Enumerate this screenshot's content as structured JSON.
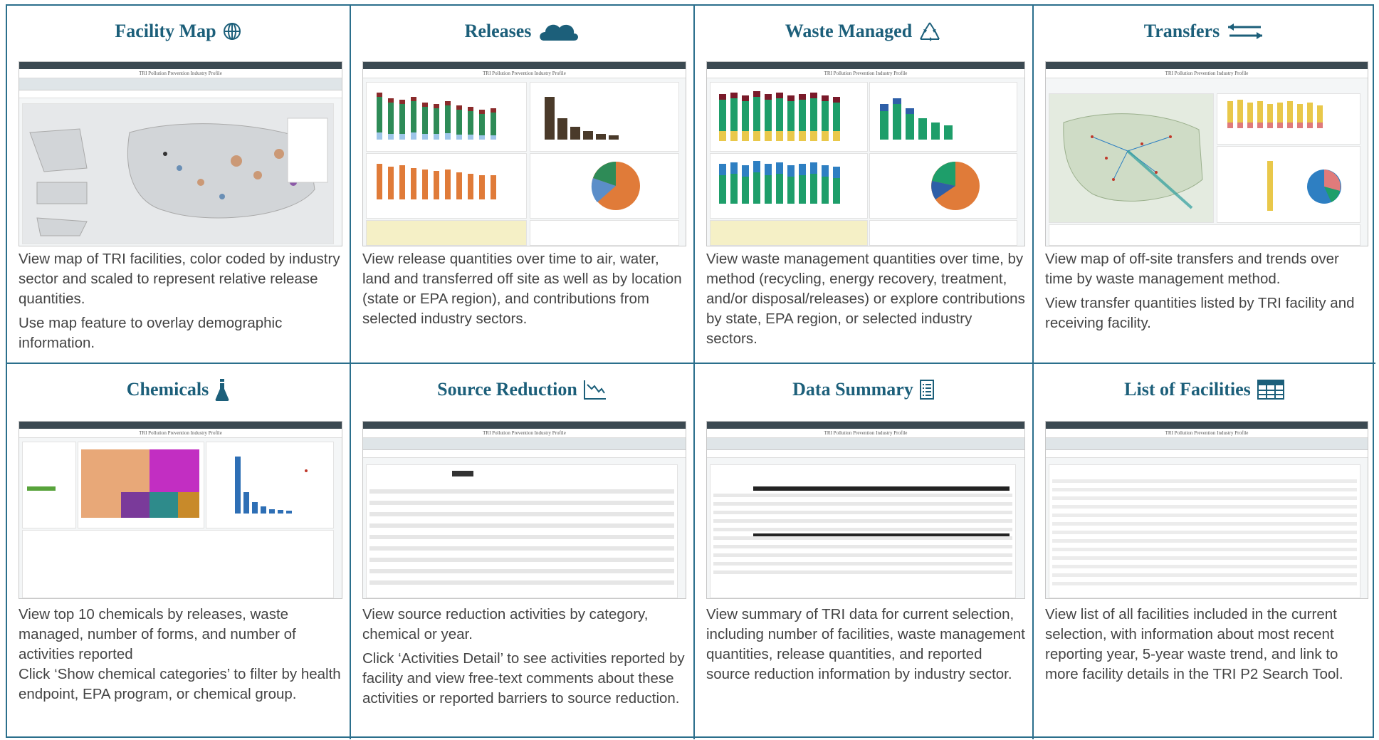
{
  "cards": [
    {
      "title": "Facility Map",
      "icon": "globe-icon",
      "desc": [
        "View map of TRI facilities, color coded by industry sector and scaled to represent relative release quantities.",
        "Use map feature to overlay demographic information."
      ]
    },
    {
      "title": "Releases",
      "icon": "cloud-icon",
      "desc": [
        "View release quantities over time to air, water, land and transferred off site as well as by location (state or EPA region), and contributions from selected industry sectors."
      ]
    },
    {
      "title": "Waste Managed",
      "icon": "recycle-icon",
      "desc": [
        "View waste management quantities over time, by method (recycling, energy recovery, treatment, and/or disposal/releases) or explore contributions by state, EPA region, or selected industry sectors."
      ]
    },
    {
      "title": "Transfers",
      "icon": "transfer-arrows-icon",
      "desc": [
        "View map of off-site transfers and trends over time by waste management method.",
        "View transfer quantities listed by TRI facility and receiving facility."
      ]
    },
    {
      "title": "Chemicals",
      "icon": "flask-icon",
      "desc": [
        "View top 10 chemicals by releases, waste managed, number of forms, and number of activities reported",
        "Click ‘Show chemical categories’ to filter by health endpoint, EPA program, or chemical group."
      ]
    },
    {
      "title": "Source Reduction",
      "icon": "trend-down-icon",
      "desc": [
        "View source reduction activities by category, chemical or year.",
        "Click ‘Activities Detail’ to see activities reported by facility and view free-text comments about these activities or reported barriers to source reduction."
      ]
    },
    {
      "title": "Data Summary",
      "icon": "list-document-icon",
      "desc": [
        "View summary of TRI data for current selection, including number of facilities, waste management quantities, release quantities, and reported source reduction information by industry sector."
      ]
    },
    {
      "title": "List of Facilities",
      "icon": "table-icon",
      "desc": [
        "View list of all facilities included in the current selection, with information about most recent reporting year, 5-year waste trend, and link to more facility details in the TRI P2 Search Tool."
      ]
    }
  ],
  "thumbnail_title": "TRI Pollution Prevention Industry Profile",
  "colors": {
    "title": "#1c5f7a",
    "border": "#2b6f8c",
    "text": "#444444"
  }
}
